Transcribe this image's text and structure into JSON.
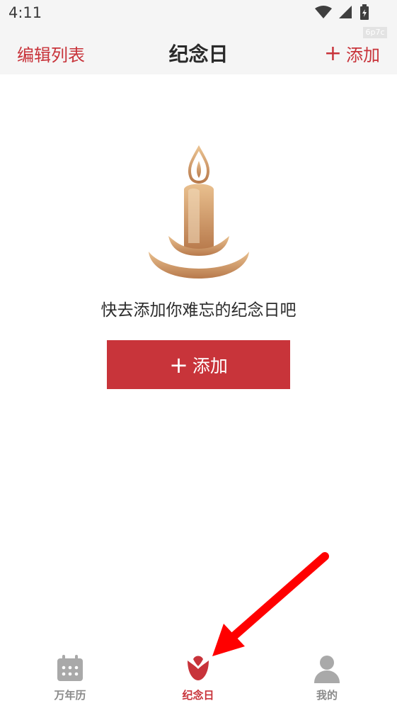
{
  "status": {
    "time": "4:11",
    "watermark": "6p7c"
  },
  "appbar": {
    "left_label": "编辑列表",
    "title": "纪念日",
    "right_plus": "+",
    "right_label": "添加"
  },
  "empty_state": {
    "message": "快去添加你难忘的纪念日吧",
    "button_plus": "+",
    "button_label": "添加"
  },
  "tabs": [
    {
      "label": "万年历",
      "icon": "calendar-icon",
      "active": false
    },
    {
      "label": "纪念日",
      "icon": "tulip-icon",
      "active": true
    },
    {
      "label": "我的",
      "icon": "person-icon",
      "active": false
    }
  ],
  "colors": {
    "accent": "#c8333a",
    "gold": "#c48a5c",
    "inactive": "#8a8a8a",
    "arrow": "#ff0000"
  }
}
